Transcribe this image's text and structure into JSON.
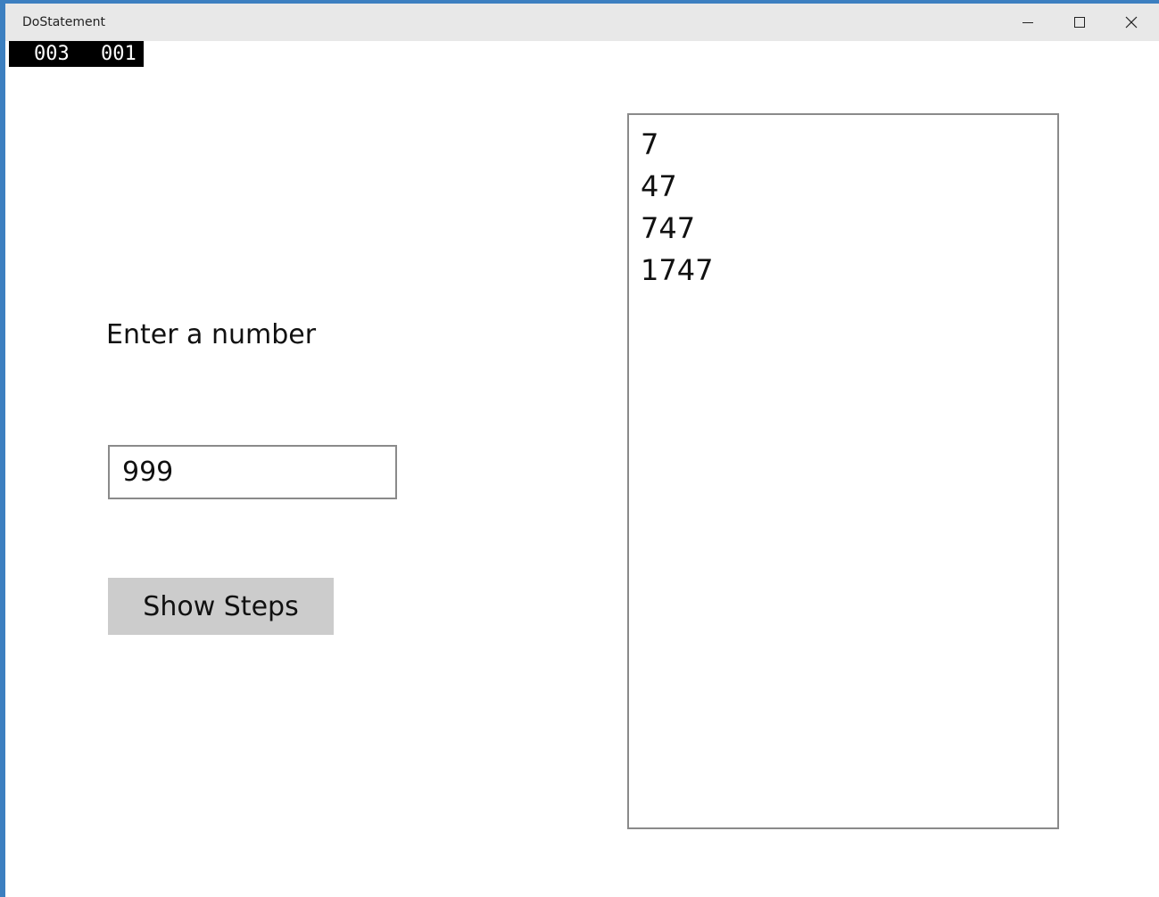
{
  "window": {
    "title": "DoStatement",
    "controls": {
      "minimize_icon": "minimize-icon",
      "maximize_icon": "maximize-icon",
      "close_icon": "close-icon"
    },
    "accent_color": "#3c7fc0"
  },
  "frame_counter": {
    "left": "003",
    "right": "001"
  },
  "form": {
    "prompt": "Enter a number",
    "input_value": "999",
    "button_label": "Show Steps"
  },
  "output": {
    "lines": [
      "7",
      "47",
      "747",
      "1747"
    ]
  }
}
